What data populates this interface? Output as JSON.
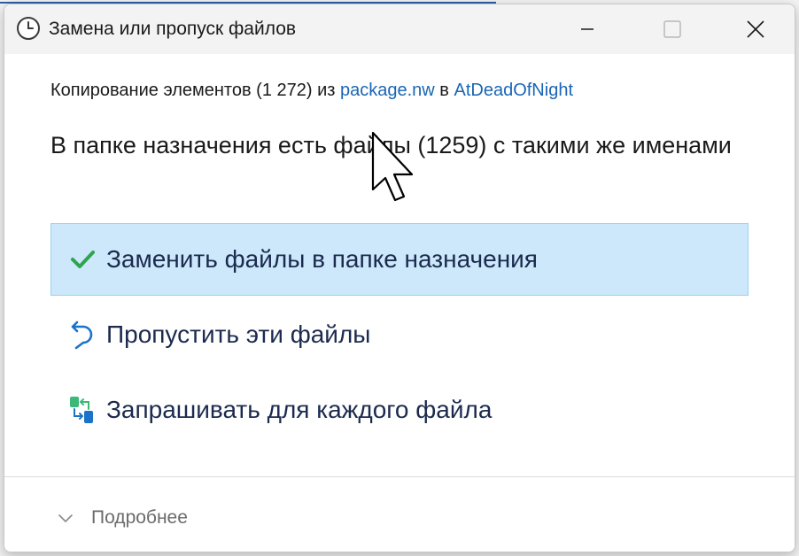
{
  "window": {
    "title": "Замена или пропуск файлов"
  },
  "copy_info": {
    "prefix": "Копирование элементов (1 272) из ",
    "source": "package.nw",
    "middle": " в ",
    "destination": "AtDeadOfNight"
  },
  "heading": "В папке назначения есть файлы (1259) с такими же именами",
  "options": [
    {
      "label": "Заменить файлы в папке назначения",
      "icon": "checkmark-icon",
      "selected": true
    },
    {
      "label": "Пропустить эти файлы",
      "icon": "undo-arrow-icon",
      "selected": false
    },
    {
      "label": "Запрашивать для каждого файла",
      "icon": "compare-files-icon",
      "selected": false
    }
  ],
  "details": {
    "label": "Подробнее",
    "icon": "chevron-down-icon"
  },
  "colors": {
    "link": "#1a66b5",
    "selected_bg": "#cce8fa",
    "check": "#2ea44f"
  }
}
